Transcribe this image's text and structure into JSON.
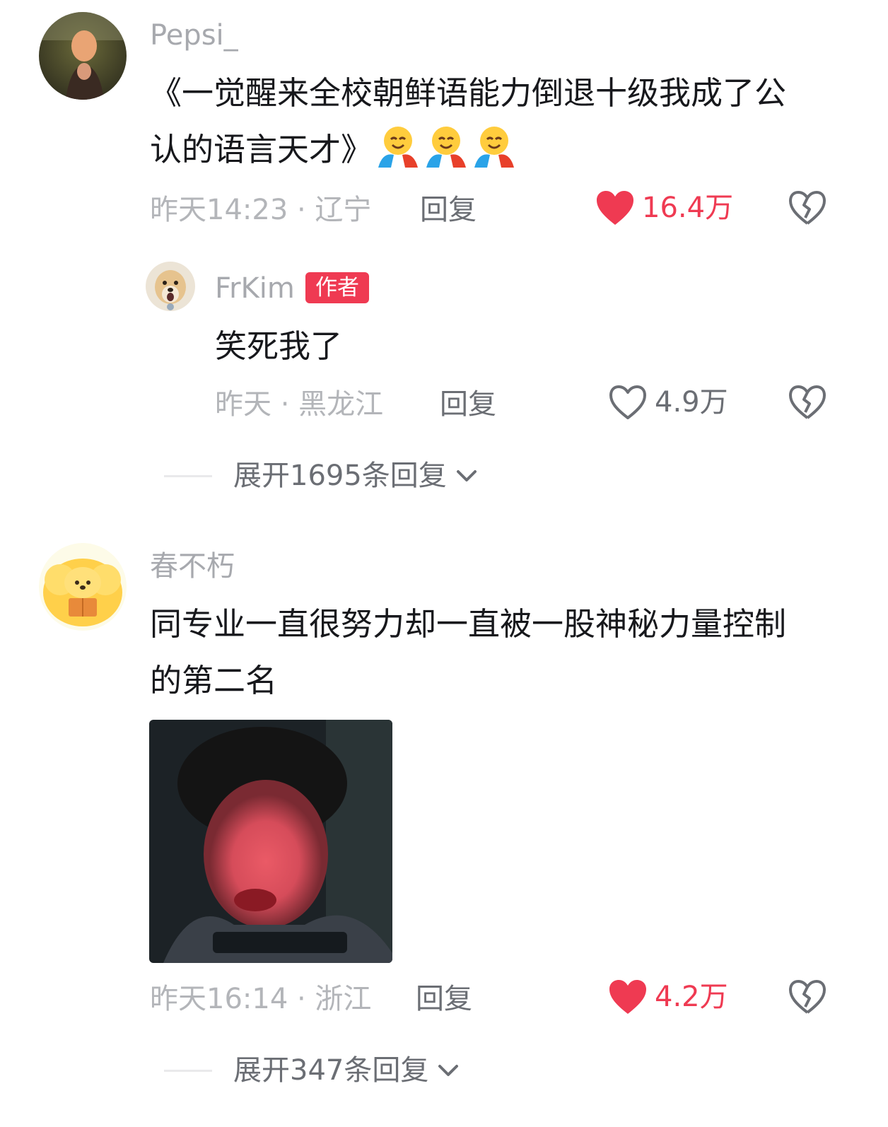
{
  "comments": [
    {
      "username": "Pepsi_",
      "text": "《一觉醒来全校朝鲜语能力倒退十级我成了公认的语言天才》",
      "emojis": [
        "hugging-face-emoji",
        "hugging-face-emoji",
        "hugging-face-emoji"
      ],
      "meta": "昨天14:23 · 辽宁",
      "reply_label": "回复",
      "likes": "16.4万",
      "liked": true,
      "replies": [
        {
          "username": "FrKim",
          "badge": "作者",
          "text": "笑死我了",
          "meta": "昨天 · 黑龙江",
          "reply_label": "回复",
          "likes": "4.9万",
          "liked": false
        }
      ],
      "expand_label": "展开1695条回复"
    },
    {
      "username": "春不朽",
      "text": "同专业一直很努力却一直被一股神秘力量控制的第二名",
      "meta": "昨天16:14 · 浙江",
      "reply_label": "回复",
      "likes": "4.2万",
      "liked": true,
      "expand_label": "展开347条回复"
    }
  ],
  "colors": {
    "accent_red": "#ef3a52",
    "username_gray": "#a7a9ae",
    "text_dark": "#17181c"
  }
}
